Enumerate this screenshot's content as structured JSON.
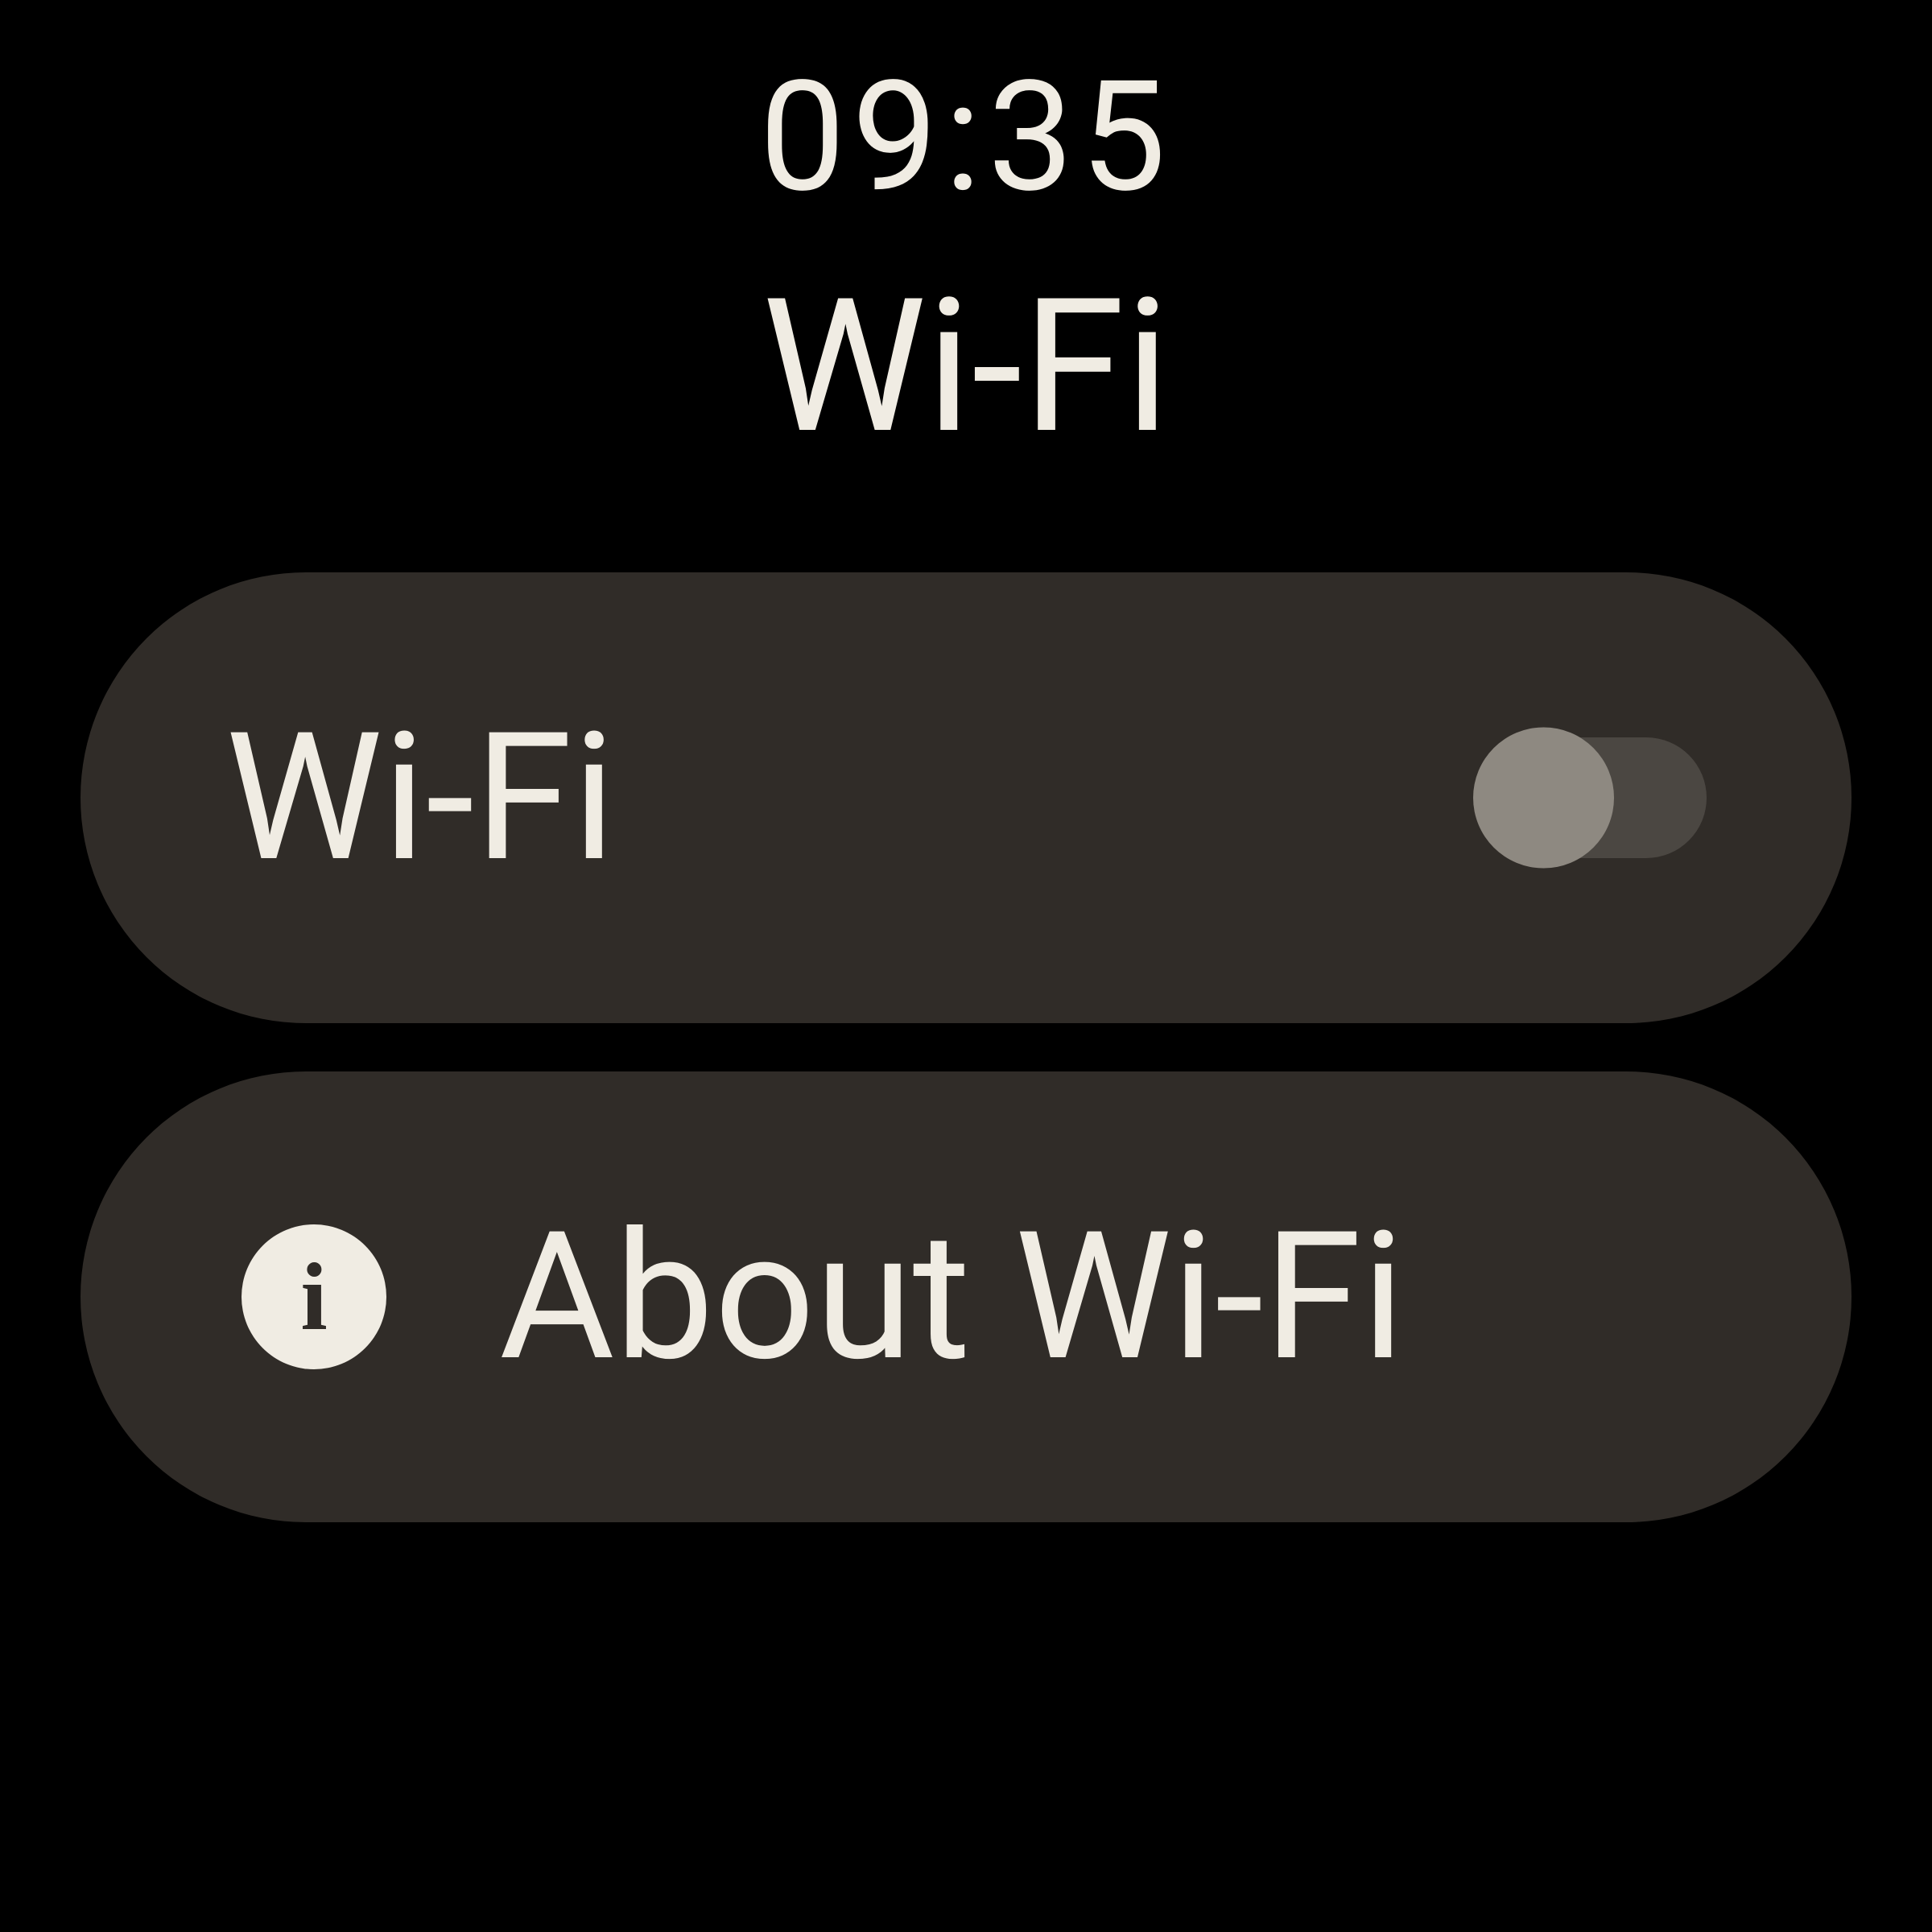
{
  "clock": "09:35",
  "page_title": "Wi-Fi",
  "toggle": {
    "label": "Wi-Fi",
    "state": "off"
  },
  "about": {
    "label": "About Wi-Fi",
    "icon_glyph": "i"
  }
}
